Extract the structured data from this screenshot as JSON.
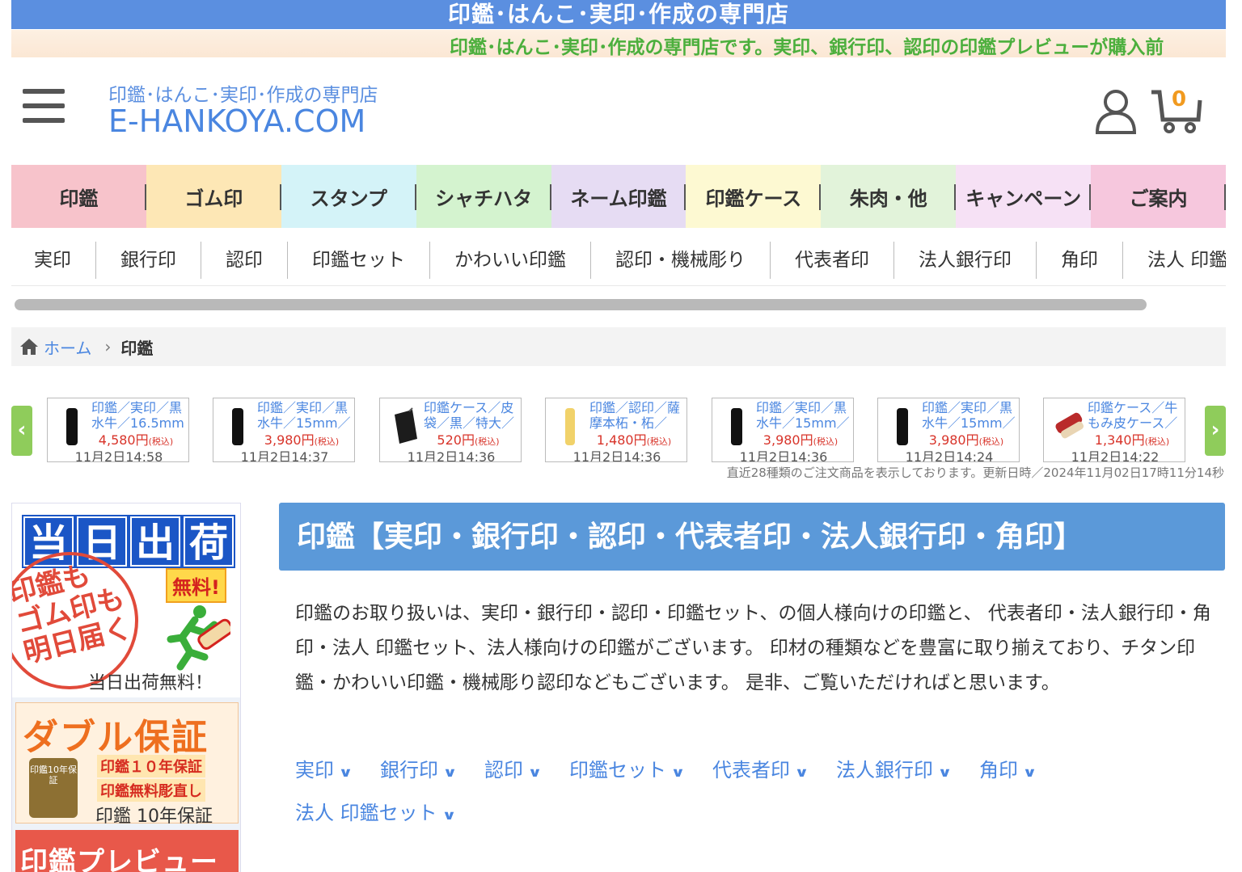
{
  "banner": {
    "title": "印鑑･はんこ･実印･作成の専門店"
  },
  "ticker": {
    "text": "印鑑･はんこ･実印･作成の専門店です。実印、銀行印、認印の印鑑プレビューが購入前"
  },
  "header": {
    "logo_sub": "印鑑･はんこ･実印･作成の専門店",
    "logo_main": "E-HANKOYA.COM",
    "cart_count": "0"
  },
  "categories": [
    {
      "label": "印鑑",
      "color": "#f7c3cb"
    },
    {
      "label": "ゴム印",
      "color": "#fde7b5"
    },
    {
      "label": "スタンプ",
      "color": "#d4f3f8"
    },
    {
      "label": "シャチハタ",
      "color": "#d4f3cf"
    },
    {
      "label": "ネーム印鑑",
      "color": "#e6dcf3"
    },
    {
      "label": "印鑑ケース",
      "color": "#fdf9d2"
    },
    {
      "label": "朱肉・他",
      "color": "#e2f3da"
    },
    {
      "label": "キャンペーン",
      "color": "#f6e1f5"
    },
    {
      "label": "ご案内",
      "color": "#f6c7dd"
    }
  ],
  "subnav": [
    "実印",
    "銀行印",
    "認印",
    "印鑑セット",
    "かわいい印鑑",
    "認印・機械彫り",
    "代表者印",
    "法人銀行印",
    "角印",
    "法人 印鑑"
  ],
  "breadcrumb": {
    "home": "ホーム",
    "separator": "›",
    "current": "印鑑"
  },
  "carousel": {
    "prev": "‹",
    "next": "›",
    "items": [
      {
        "name": "印鑑／実印／黒水牛／16.5mm",
        "price": "4,580円",
        "tax": "(税込)",
        "date": "11月2日14:58",
        "thumb": "black"
      },
      {
        "name": "印鑑／実印／黒水牛／15mm／",
        "price": "3,980円",
        "tax": "(税込)",
        "date": "11月2日14:37",
        "thumb": "black"
      },
      {
        "name": "印鑑ケース／皮袋／黒／特大／",
        "price": "520円",
        "tax": "(税込)",
        "date": "11月2日14:36",
        "thumb": "pouch"
      },
      {
        "name": "印鑑／認印／薩摩本柘・柘／",
        "price": "1,480円",
        "tax": "(税込)",
        "date": "11月2日14:36",
        "thumb": "wood"
      },
      {
        "name": "印鑑／実印／黒水牛／15mm／",
        "price": "3,980円",
        "tax": "(税込)",
        "date": "11月2日14:36",
        "thumb": "black"
      },
      {
        "name": "印鑑／実印／黒水牛／15mm／",
        "price": "3,980円",
        "tax": "(税込)",
        "date": "11月2日14:24",
        "thumb": "black"
      },
      {
        "name": "印鑑ケース／牛もみ皮ケース／",
        "price": "1,340円",
        "tax": "(税込)",
        "date": "11月2日14:22",
        "thumb": "case"
      }
    ],
    "note": "直近28種類のご注文商品を表示しております。更新日時／2024年11月02日17時11分14秒"
  },
  "sidebar": {
    "banner1": {
      "chars": [
        "当",
        "日",
        "出",
        "荷"
      ],
      "line1": "印鑑も",
      "line2": "ゴム印も",
      "line3": "明日届く",
      "free": "無料!",
      "caption": "当日出荷無料！"
    },
    "banner2": {
      "title": "ダブル保証",
      "seal": "印鑑10年保証",
      "tag1": "印鑑１０年保証",
      "tag2": "印鑑無料彫直し",
      "caption": "印鑑 10年保証"
    },
    "banner3": {
      "title": "印鑑プレビュー"
    }
  },
  "main": {
    "title": "印鑑【実印・銀行印・認印・代表者印・法人銀行印・角印】",
    "description": "印鑑のお取り扱いは、実印・銀行印・認印・印鑑セット、の個人様向けの印鑑と、 代表者印・法人銀行印・角印・法人 印鑑セット、法人様向けの印鑑がございます。 印材の種類などを豊富に取り揃えており、チタン印鑑・かわいい印鑑・機械彫り認印などもございます。 是非、ご覧いただければと思います。",
    "links": [
      "実印",
      "銀行印",
      "認印",
      "印鑑セット",
      "代表者印",
      "法人銀行印",
      "角印",
      "法人 印鑑セット"
    ]
  },
  "colors": {
    "accent": "#5b8fe0",
    "link": "#4a86e0",
    "price": "#d8342a",
    "ticker": "#4caf3d",
    "title_bg": "#5b99d9"
  }
}
